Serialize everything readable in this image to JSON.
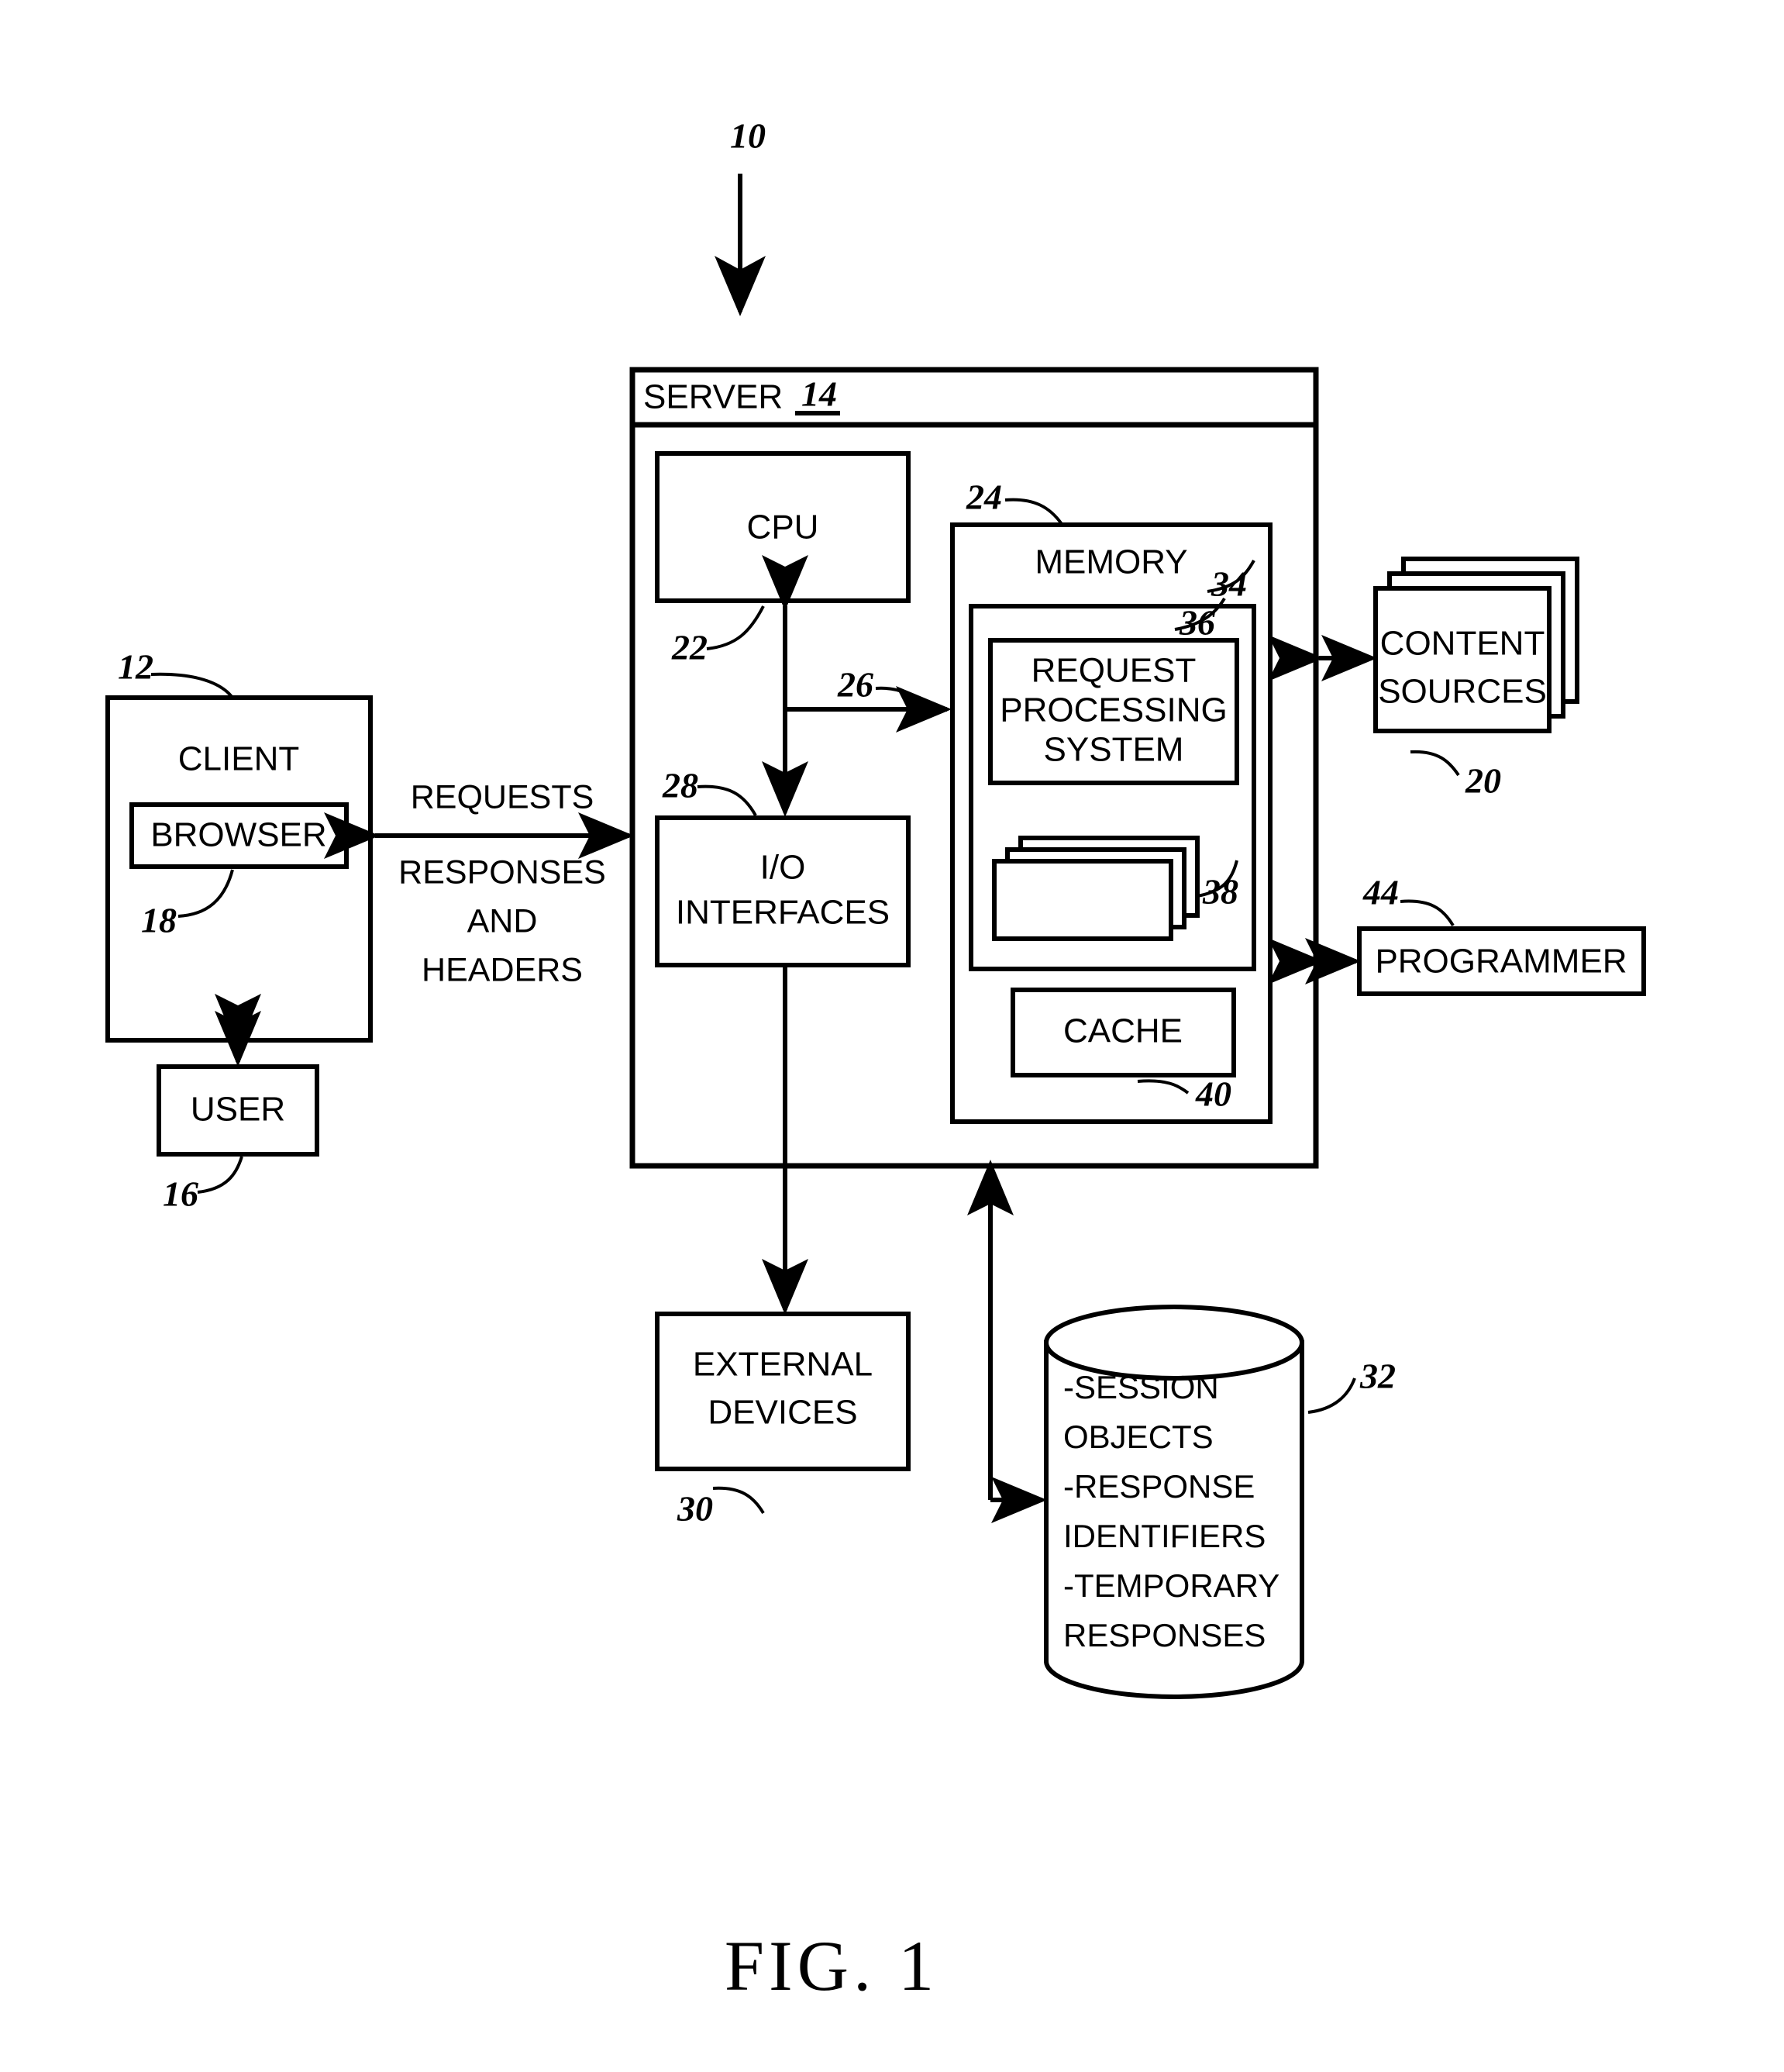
{
  "figure": {
    "caption": "FIG. 1",
    "system_ref": "10"
  },
  "client_side": {
    "client": {
      "label": "CLIENT",
      "ref": "12"
    },
    "browser": {
      "label": "BROWSER",
      "ref": "18"
    },
    "user": {
      "label": "USER",
      "ref": "16"
    }
  },
  "flows": {
    "requests": "REQUESTS",
    "responses_line1": "RESPONSES",
    "responses_line2": "AND",
    "responses_line3": "HEADERS"
  },
  "server": {
    "label": "SERVER",
    "ref": "14",
    "cpu": {
      "label": "CPU",
      "ref": "22"
    },
    "bus": {
      "ref": "26"
    },
    "io_interfaces": {
      "line1": "I/O",
      "line2": "INTERFACES",
      "ref": "28"
    },
    "memory": {
      "label": "MEMORY",
      "ref": "24",
      "inner_container_ref": "34",
      "request_processing_system": {
        "line1": "REQUEST",
        "line2": "PROCESSING",
        "line3": "SYSTEM",
        "ref": "36"
      },
      "stacked_objects_ref": "38",
      "cache": {
        "label": "CACHE",
        "ref": "40"
      }
    }
  },
  "external": {
    "content_sources": {
      "line1": "CONTENT",
      "line2": "SOURCES",
      "ref": "20"
    },
    "programmer": {
      "label": "PROGRAMMER",
      "ref": "44"
    },
    "external_devices": {
      "line1": "EXTERNAL",
      "line2": "DEVICES",
      "ref": "30"
    },
    "datastore": {
      "ref": "32",
      "items": [
        "-SESSION",
        " OBJECTS",
        "-RESPONSE",
        " IDENTIFIERS",
        "-TEMPORARY",
        " RESPONSES"
      ]
    }
  },
  "colors": {
    "ink": "#000000",
    "paper": "#ffffff"
  }
}
